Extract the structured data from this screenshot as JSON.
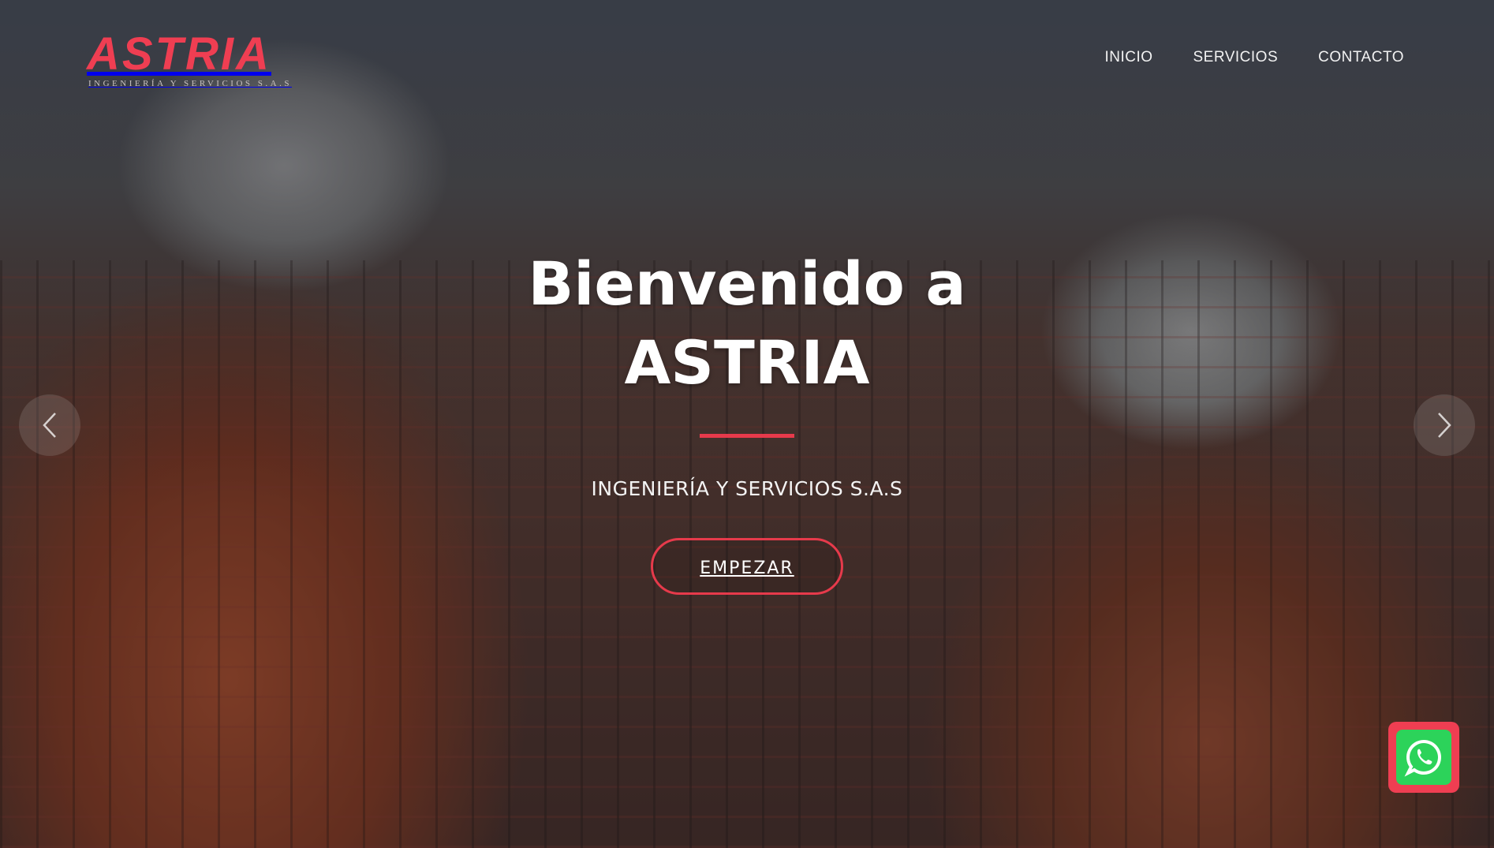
{
  "brand": {
    "name": "ASTRIA",
    "tagline": "INGENIERÍA Y SERVICIOS S.A.S",
    "accent_color": "#ef3e52"
  },
  "nav": {
    "items": [
      {
        "label": "INICIO"
      },
      {
        "label": "SERVICIOS"
      },
      {
        "label": "CONTACTO"
      }
    ]
  },
  "hero": {
    "title_line1": "Bienvenido a",
    "title_line2": "ASTRIA",
    "subtitle": "INGENIERÍA Y SERVICIOS S.A.S",
    "cta_label": "EMPEZAR"
  },
  "carousel": {
    "prev_icon": "chevron-left-icon",
    "next_icon": "chevron-right-icon"
  },
  "whatsapp": {
    "icon": "whatsapp-icon",
    "color": "#2cd35a"
  }
}
